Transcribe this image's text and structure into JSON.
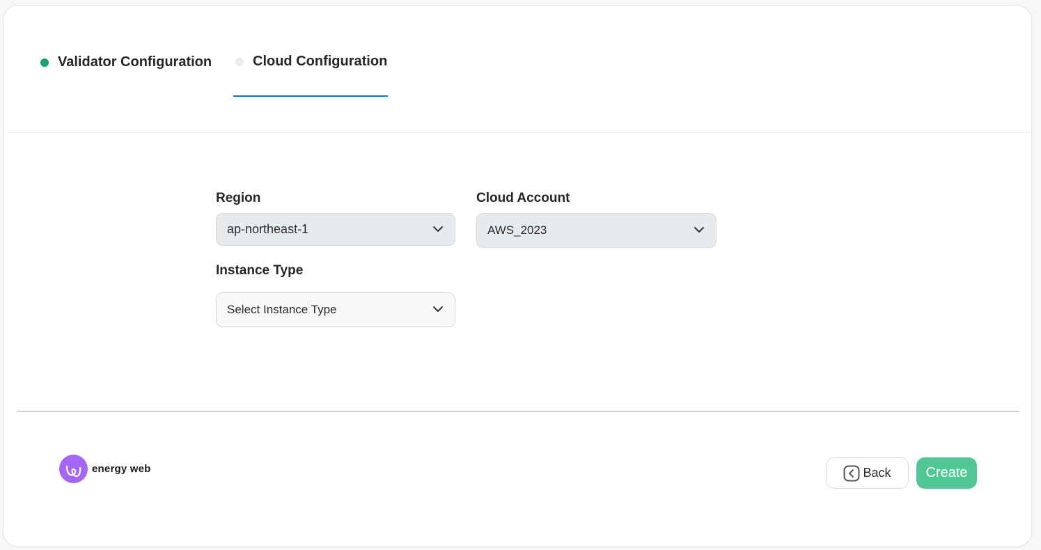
{
  "steps": [
    {
      "label": "Validator Configuration",
      "status_color": "#16a370"
    },
    {
      "label": "Cloud Configuration",
      "status_color": "#ececec",
      "active": true
    }
  ],
  "form": {
    "region": {
      "label": "Region",
      "value": "ap-northeast-1"
    },
    "cloud_account": {
      "label": "Cloud Account",
      "value": "AWS_2023"
    },
    "instance_type": {
      "label": "Instance Type",
      "placeholder": "Select Instance Type"
    }
  },
  "footer": {
    "logo_text": "energy web",
    "back_label": "Back",
    "create_label": "Create"
  },
  "colors": {
    "accent_underline": "#1f6fd1",
    "create_button": "#52c796",
    "logo": "#a566f5"
  },
  "icons": {
    "dropdown": "chevron-down-icon",
    "back": "chevron-left-box-icon",
    "logo": "energy-web-logo-icon"
  }
}
